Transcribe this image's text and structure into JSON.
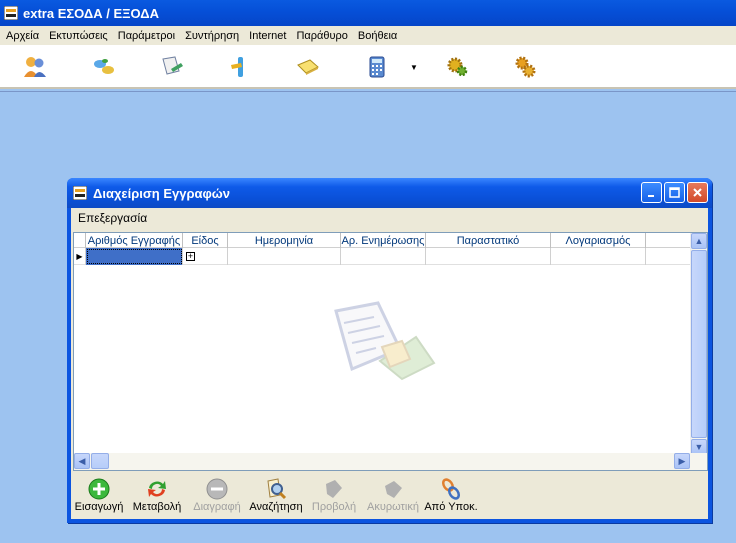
{
  "app": {
    "title": "extra ΕΣΟΔΑ / ΕΞΟΔΑ",
    "menu": [
      "Αρχεία",
      "Εκτυπώσεις",
      "Παράμετροι",
      "Συντήρηση",
      "Internet",
      "Παράθυρο",
      "Βοήθεια"
    ]
  },
  "toolbar": {
    "icons": [
      "users-icon",
      "connect-icon",
      "document-edit-icon",
      "tools-icon",
      "book-icon",
      "calculator-icon",
      "gear-icon",
      "gears-icon"
    ]
  },
  "child": {
    "title": "Διαχείριση Εγγραφών",
    "menu": [
      "Επεξεργασία"
    ],
    "columns": [
      "Αριθμός Εγγραφής",
      "Είδος",
      "Ημερομηνία",
      "Αρ. Ενημέρωσης",
      "Παραστατικό",
      "Λογαριασμός"
    ],
    "row": {
      "expand": "+"
    },
    "actions": [
      {
        "label": "Εισαγωγή",
        "icon": "add-icon",
        "enabled": true
      },
      {
        "label": "Μεταβολή",
        "icon": "refresh-icon",
        "enabled": true
      },
      {
        "label": "Διαγραφή",
        "icon": "remove-icon",
        "enabled": false
      },
      {
        "label": "Αναζήτηση",
        "icon": "search-icon",
        "enabled": true
      },
      {
        "label": "Προβολή",
        "icon": "view-icon",
        "enabled": false
      },
      {
        "label": "Ακυρωτική",
        "icon": "cancel-doc-icon",
        "enabled": false
      },
      {
        "label": "Από Υποκ.",
        "icon": "link-icon",
        "enabled": true
      }
    ]
  },
  "colors": {
    "xp_blue": "#0a54e0",
    "desktop": "#9dc3f0",
    "face": "#ece9d8",
    "header_text": "#00377a"
  }
}
